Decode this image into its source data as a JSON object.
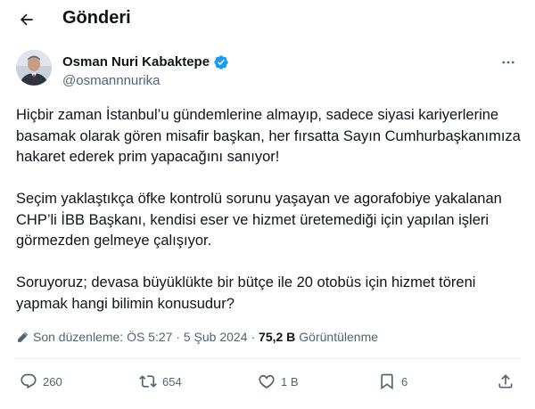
{
  "header": {
    "back_icon": "arrow-left-icon",
    "title": "Gönderi"
  },
  "author": {
    "name": "Osman Nuri Kabaktepe",
    "handle": "@osmannnurika",
    "verified_color": "#1d9bf0",
    "more_icon": "more-horizontal-icon"
  },
  "post": {
    "paragraphs": [
      "Hiçbir zaman İstanbul’u gündemlerine almayıp, sadece siyasi kariyerlerine basamak olarak gören misafir başkan, her fırsatta Sayın Cumhurbaşkanımıza hakaret ederek prim yapacağını sanıyor!",
      "Seçim yaklaştıkça öfke kontrolü sorunu yaşayan ve agorafobiye yakalanan CHP’li İBB Başkanı, kendisi eser ve hizmet üretemediği için yapılan işleri görmezden gelmeye çalışıyor.",
      "Soruyoruz; devasa büyüklükte bir bütçe ile 20 otobüs için hizmet töreni yapmak hangi bilimin konusudur?"
    ]
  },
  "meta": {
    "edited_icon": "pencil-icon",
    "edited_label": "Son düzenleme: ÖS 5:27 · 5 Şub 2024 ·",
    "views_count": "75,2 B",
    "views_label": "Görüntülenme"
  },
  "actions": {
    "replies": "260",
    "reposts": "654",
    "likes": "1 B",
    "bookmarks": "6"
  },
  "colors": {
    "text": "#0f1419",
    "secondary": "#536471",
    "divider": "#eff3f4"
  }
}
